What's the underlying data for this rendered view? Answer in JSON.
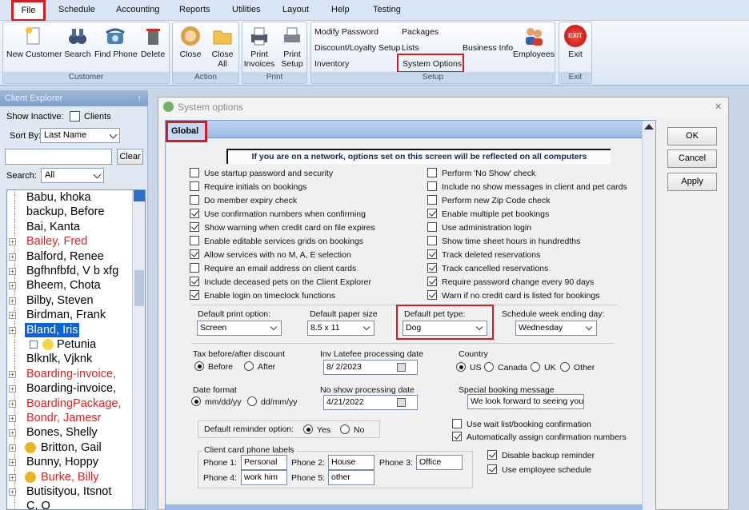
{
  "menu": {
    "file": "File",
    "items": [
      "Schedule",
      "Accounting",
      "Reports",
      "Utilities",
      "Layout",
      "Help",
      "Testing"
    ]
  },
  "ribbon": {
    "customer_group": "Customer",
    "action_group": "Action",
    "print_group": "Print",
    "setup_group": "Setup",
    "exit_group": "Exit",
    "new_customer": "New Customer",
    "search": "Search",
    "find_phone": "Find Phone",
    "delete": "Delete",
    "close": "Close",
    "close_all_1": "Close",
    "close_all_2": "All",
    "print_invoices_1": "Print",
    "print_invoices_2": "Invoices",
    "print_setup_1": "Print",
    "print_setup_2": "Setup",
    "modify_password": "Modify Password",
    "packages": "Packages",
    "discount_setup": "Discount/Loyalty Setup",
    "lists": "Lists",
    "business_info": "Business Info",
    "inventory": "Inventory",
    "system_options": "System Options",
    "employees": "Employees",
    "exit": "Exit",
    "exit_icon_text": "EXIT"
  },
  "explorer": {
    "title": "Client Explorer",
    "pin": "↑",
    "show_inactive": "Show Inactive:",
    "clients": "Clients",
    "sort_by": "Sort By:",
    "sort_value": "Last Name",
    "clear": "Clear",
    "search_label": "Search:",
    "search_value": "All",
    "tree": [
      {
        "name": "Babu, khoka",
        "color": "#000",
        "expander": false,
        "icon": ""
      },
      {
        "name": "backup, Before",
        "color": "#000",
        "expander": false,
        "icon": ""
      },
      {
        "name": "Bai, Kanta",
        "color": "#000",
        "expander": false,
        "icon": ""
      },
      {
        "name": "Bailey, Fred",
        "color": "#e0201c",
        "expander": true,
        "icon": ""
      },
      {
        "name": "Balford, Renee",
        "color": "#000",
        "expander": true,
        "icon": ""
      },
      {
        "name": "Bgfhnfbfd, V b xfg",
        "color": "#000",
        "expander": true,
        "icon": ""
      },
      {
        "name": "Bheem, Chota",
        "color": "#000",
        "expander": true,
        "icon": ""
      },
      {
        "name": "Bilby, Steven",
        "color": "#000",
        "expander": true,
        "icon": ""
      },
      {
        "name": "Birdman, Frank",
        "color": "#000",
        "expander": true,
        "icon": ""
      },
      {
        "name": "Bland, Iris",
        "color": "#fff",
        "expander": true,
        "icon": "",
        "selected": true
      },
      {
        "name": "Petunia",
        "color": "#000",
        "expander": false,
        "icon": "pet",
        "child": true
      },
      {
        "name": "Blknlk, Vjknk",
        "color": "#000",
        "expander": false,
        "icon": ""
      },
      {
        "name": "Boarding-invoice,",
        "color": "#e0201c",
        "expander": true,
        "icon": ""
      },
      {
        "name": "Boarding-invoice,",
        "color": "#000",
        "expander": true,
        "icon": ""
      },
      {
        "name": "BoardingPackage,",
        "color": "#e0201c",
        "expander": true,
        "icon": ""
      },
      {
        "name": "Bondr, Jamesr",
        "color": "#e0201c",
        "expander": true,
        "icon": ""
      },
      {
        "name": "Bones, Shelly",
        "color": "#000",
        "expander": true,
        "icon": ""
      },
      {
        "name": "Britton, Gail",
        "color": "#000",
        "expander": true,
        "icon": "smile"
      },
      {
        "name": "Bunny, Hoppy",
        "color": "#000",
        "expander": true,
        "icon": ""
      },
      {
        "name": "Burke, Billy",
        "color": "#e0201c",
        "expander": true,
        "icon": "thumb"
      },
      {
        "name": "Butisityou, Itsnot",
        "color": "#000",
        "expander": true,
        "icon": ""
      },
      {
        "name": "C, Q",
        "color": "#000",
        "expander": false,
        "icon": ""
      }
    ]
  },
  "dialog": {
    "title": "System options",
    "close": "×",
    "tab": "Global",
    "network_note": "If you are on a network, options set on this screen will be reflected on all computers",
    "left_options": [
      {
        "label": "Use startup password and security",
        "checked": false
      },
      {
        "label": "Require initials on bookings",
        "checked": false
      },
      {
        "label": "Do member expiry check",
        "checked": false
      },
      {
        "label": "Use confirmation numbers when confirming",
        "checked": true
      },
      {
        "label": "Show warning when credit card on file expires",
        "checked": true
      },
      {
        "label": "Enable editable services grids on bookings",
        "checked": false
      },
      {
        "label": "Allow services with no M, A, E selection",
        "checked": true
      },
      {
        "label": "Require an email address on client cards",
        "checked": false
      },
      {
        "label": "Include deceased pets on the Client Explorer",
        "checked": true
      },
      {
        "label": "Enable login on timeclock functions",
        "checked": true
      }
    ],
    "right_options": [
      {
        "label": "Perform 'No Show' check",
        "checked": false
      },
      {
        "label": "Include no show messages in client and pet cards",
        "checked": false
      },
      {
        "label": "Perform new Zip Code check",
        "checked": false
      },
      {
        "label": "Enable multiple pet bookings",
        "checked": true
      },
      {
        "label": "Use administration login",
        "checked": false
      },
      {
        "label": "Show time sheet hours in hundredths",
        "checked": false
      },
      {
        "label": "Track deleted reservations",
        "checked": true
      },
      {
        "label": "Track cancelled reservations",
        "checked": true
      },
      {
        "label": "Require password change every 90 days",
        "checked": true
      },
      {
        "label": "Warn if no credit card is listed for bookings",
        "checked": true
      }
    ],
    "default_print_option_label": "Default print option:",
    "default_print_option": "Screen",
    "default_paper_size_label": "Default paper size",
    "default_paper_size": "8.5 x 11",
    "default_pet_type_label": "Default pet type:",
    "default_pet_type": "Dog",
    "week_ending_label": "Schedule week ending day:",
    "week_ending": "Wednesday",
    "tax_label": "Tax before/after discount",
    "tax_before": "Before",
    "tax_after": "After",
    "inv_latefee_label": "Inv Latefee processing date",
    "inv_latefee_date": "8/  2/2023",
    "country_label": "Country",
    "country_us": "US",
    "country_canada": "Canada",
    "country_uk": "UK",
    "country_other": "Other",
    "date_format_label": "Date format",
    "date_mdy": "mm/dd/yy",
    "date_dmy": "dd/mm/yy",
    "no_show_label": "No show processing date",
    "no_show_date": "4/21/2022",
    "special_msg_label": "Special booking message",
    "special_msg": "We look forward to seeing you!",
    "reminder_label": "Default reminder option:",
    "reminder_yes": "Yes",
    "reminder_no": "No",
    "use_wait_list": "Use wait list/booking confirmation",
    "auto_confirm": "Automatically assign confirmation numbers",
    "disable_backup": "Disable backup reminder",
    "use_employee_schedule": "Use employee schedule",
    "phone_labels_title": "Client card phone labels",
    "phone1_label": "Phone 1:",
    "phone1": "Personal",
    "phone2_label": "Phone 2:",
    "phone2": "House",
    "phone3_label": "Phone 3:",
    "phone3": "Office",
    "phone4_label": "Phone 4:",
    "phone4": "work him",
    "phone5_label": "Phone 5:",
    "phone5": "other",
    "ok": "OK",
    "cancel": "Cancel",
    "apply": "Apply"
  },
  "colors": {
    "highlight": "#d71920",
    "selection": "#0a64d8",
    "client_red": "#e0201c"
  }
}
